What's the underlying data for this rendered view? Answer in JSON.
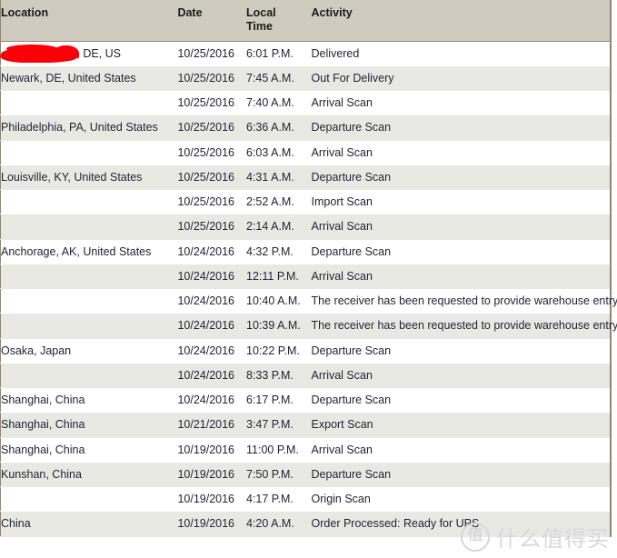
{
  "table": {
    "columns": [
      {
        "key": "location",
        "label": "Location"
      },
      {
        "key": "date",
        "label": "Date"
      },
      {
        "key": "time",
        "label": "Local\nTime"
      },
      {
        "key": "activity",
        "label": "Activity"
      }
    ],
    "header": {
      "location": "Location",
      "date": "Date",
      "time_line1": "Local",
      "time_line2": "Time",
      "activity": "Activity"
    },
    "rows": [
      {
        "location": ", DE, US",
        "location_redacted": true,
        "date": "10/25/2016",
        "time": "6:01 P.M.",
        "activity": "Delivered"
      },
      {
        "location": "Newark, DE, United States",
        "date": "10/25/2016",
        "time": "7:45 A.M.",
        "activity": "Out For Delivery"
      },
      {
        "location": "",
        "date": "10/25/2016",
        "time": "7:40 A.M.",
        "activity": "Arrival Scan"
      },
      {
        "location": "Philadelphia, PA, United States",
        "date": "10/25/2016",
        "time": "6:36 A.M.",
        "activity": "Departure Scan"
      },
      {
        "location": "",
        "date": "10/25/2016",
        "time": "6:03 A.M.",
        "activity": "Arrival Scan"
      },
      {
        "location": "Louisville, KY, United States",
        "date": "10/25/2016",
        "time": "4:31 A.M.",
        "activity": "Departure Scan"
      },
      {
        "location": "",
        "date": "10/25/2016",
        "time": "2:52 A.M.",
        "activity": "Import Scan"
      },
      {
        "location": "",
        "date": "10/25/2016",
        "time": "2:14 A.M.",
        "activity": "Arrival Scan"
      },
      {
        "location": "Anchorage, AK, United States",
        "date": "10/24/2016",
        "time": "4:32 P.M.",
        "activity": "Departure Scan"
      },
      {
        "location": "",
        "date": "10/24/2016",
        "time": "12:11 P.M.",
        "activity": "Arrival Scan"
      },
      {
        "location": "",
        "date": "10/24/2016",
        "time": "10:40 A.M.",
        "activity": "The receiver has been requested to provide warehouse entry details necessary for clearance. / Your package was released by the clearing agency."
      },
      {
        "location": "",
        "date": "10/24/2016",
        "time": "10:39 A.M.",
        "activity": "The receiver has been requested to provide warehouse entry details necessary for clearance."
      },
      {
        "location": "Osaka, Japan",
        "date": "10/24/2016",
        "time": "10:22 P.M.",
        "activity": "Departure Scan"
      },
      {
        "location": "",
        "date": "10/24/2016",
        "time": "8:33 P.M.",
        "activity": "Arrival Scan"
      },
      {
        "location": "Shanghai, China",
        "date": "10/24/2016",
        "time": "6:17 P.M.",
        "activity": "Departure Scan"
      },
      {
        "location": "Shanghai, China",
        "date": "10/21/2016",
        "time": "3:47 P.M.",
        "activity": "Export Scan"
      },
      {
        "location": "Shanghai, China",
        "date": "10/19/2016",
        "time": "11:00 P.M.",
        "activity": "Arrival Scan"
      },
      {
        "location": "Kunshan, China",
        "date": "10/19/2016",
        "time": "7:50 P.M.",
        "activity": "Departure Scan"
      },
      {
        "location": "",
        "date": "10/19/2016",
        "time": "4:17 P.M.",
        "activity": "Origin Scan"
      },
      {
        "location": "China",
        "date": "10/19/2016",
        "time": "4:20 A.M.",
        "activity": "Order Processed: Ready for UPS"
      }
    ]
  },
  "watermark": {
    "badge_glyph": "值",
    "text": "什么值得买"
  },
  "colors": {
    "header_background": "#d0cbbf",
    "header_border": "#8c8673",
    "row_odd_background": "#ffffff",
    "row_even_background": "#e9e9e4",
    "text": "#232336",
    "redaction": "#fb0007",
    "watermark": "#d8d8d8"
  }
}
